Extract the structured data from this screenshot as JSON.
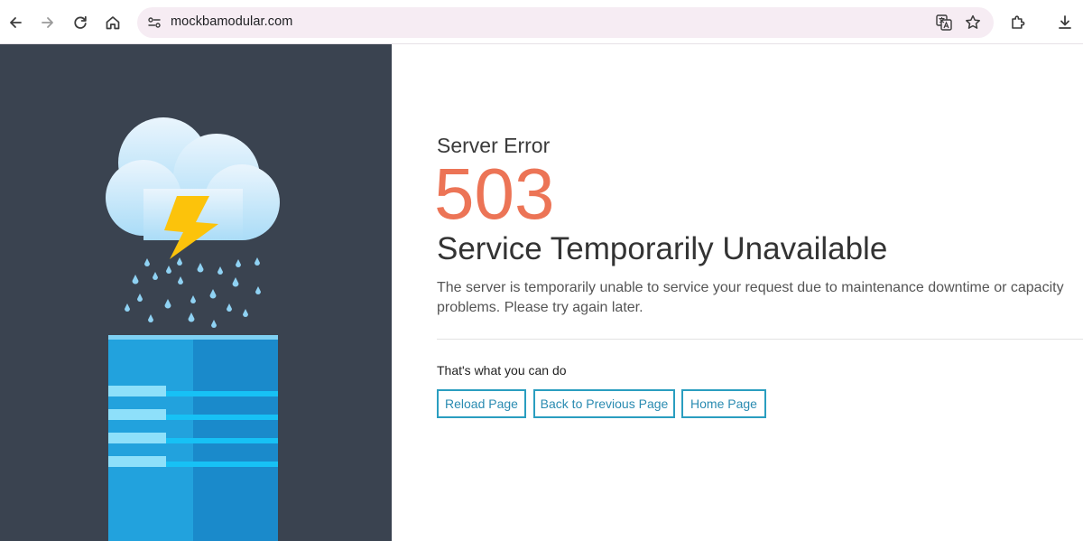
{
  "browser": {
    "url": "mockbamodular.com"
  },
  "error": {
    "kicker": "Server Error",
    "code": "503",
    "headline": "Service Temporarily Unavailable",
    "description": "The server is temporarily unable to service your request due to maintenance downtime or capacity problems. Please try again later."
  },
  "actions": {
    "label": "That's what you can do",
    "reload": "Reload Page",
    "back": "Back to Previous Page",
    "home": "Home Page"
  },
  "colors": {
    "panel": "#3a4350",
    "accent": "#ec7456",
    "button": "#2a9ec0"
  }
}
